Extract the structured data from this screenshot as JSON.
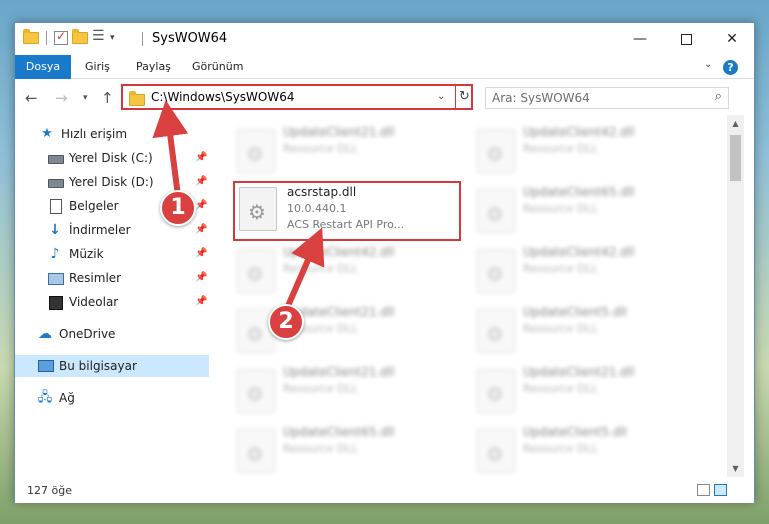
{
  "window": {
    "title": "SysWOW64"
  },
  "ribbon": {
    "tabs": [
      {
        "label": "Dosya"
      },
      {
        "label": "Giriş"
      },
      {
        "label": "Paylaş"
      },
      {
        "label": "Görünüm"
      }
    ]
  },
  "address": {
    "path": "C:\\Windows\\SysWOW64"
  },
  "search": {
    "placeholder": "Ara: SysWOW64"
  },
  "sidebar": {
    "items": [
      {
        "label": "Hızlı erişim",
        "icon": "star-icon"
      },
      {
        "label": "Yerel Disk (C:)",
        "icon": "drive-icon"
      },
      {
        "label": "Yerel Disk (D:)",
        "icon": "drive-icon"
      },
      {
        "label": "Belgeler",
        "icon": "documents-icon"
      },
      {
        "label": "İndirmeler",
        "icon": "downloads-icon"
      },
      {
        "label": "Müzik",
        "icon": "music-icon"
      },
      {
        "label": "Resimler",
        "icon": "pictures-icon"
      },
      {
        "label": "Videolar",
        "icon": "videos-icon"
      },
      {
        "label": "OneDrive",
        "icon": "cloud-icon"
      },
      {
        "label": "Bu bilgisayar",
        "icon": "computer-icon"
      },
      {
        "label": "Ağ",
        "icon": "network-icon"
      }
    ]
  },
  "files": {
    "left": [
      {
        "name": "UpdateClient21.dll",
        "type": "Resource DLL"
      },
      {
        "name": "acsrstap.dll",
        "version": "10.0.440.1",
        "description": "ACS Restart API Pro..."
      },
      {
        "name": "UpdateClient42.dll",
        "type": "Resource DLL"
      },
      {
        "name": "UpdateClient21.dll",
        "type": "Resource DLL"
      },
      {
        "name": "UpdateClient21.dll",
        "type": "Resource DLL"
      },
      {
        "name": "UpdateClient65.dll",
        "type": "Resource DLL"
      }
    ],
    "right": [
      {
        "name": "UpdateClient42.dll",
        "type": "Resource DLL"
      },
      {
        "name": "UpdateClient65.dll",
        "type": "Resource DLL"
      },
      {
        "name": "UpdateClient42.dll",
        "type": "Resource DLL"
      },
      {
        "name": "UpdateClient5.dll",
        "type": "Resource DLL"
      },
      {
        "name": "UpdateClient21.dll",
        "type": "Resource DLL"
      },
      {
        "name": "UpdateClient5.dll",
        "type": "Resource DLL"
      }
    ]
  },
  "status": {
    "count": "127 öğe"
  },
  "callouts": {
    "one": "1",
    "two": "2"
  },
  "colors": {
    "accent": "#1979ca",
    "highlight": "#d43838",
    "callout": "#d94040"
  }
}
